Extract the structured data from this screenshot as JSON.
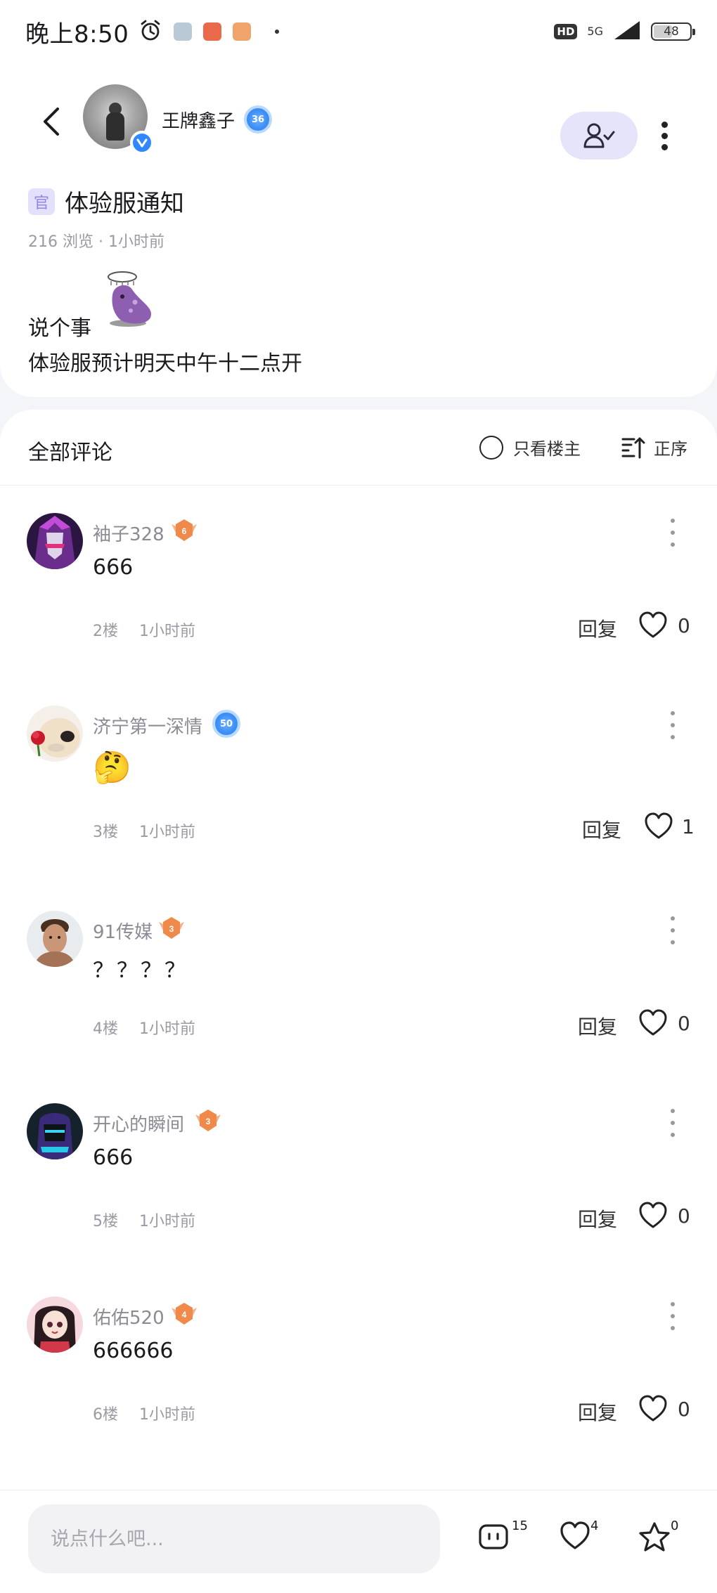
{
  "status_bar": {
    "time": "晚上8:50",
    "network_hd": "HD",
    "network_type": "5G",
    "battery_level": "48",
    "battery_fraction": 0.48
  },
  "post": {
    "author_name": "王牌鑫子",
    "author_level": "36",
    "official_tag": "官",
    "title": "体验服通知",
    "meta": "216 浏览 · 1小时前",
    "body_line_1": "说个事",
    "body_line_2": "体验服预计明天中午十二点开"
  },
  "comments_header": {
    "title": "全部评论",
    "op_only_label": "只看楼主",
    "sort_label": "正序"
  },
  "comments": [
    {
      "name": "袖子328",
      "level": "6",
      "badge": "orange",
      "text": "666",
      "floor": "2楼",
      "time": "1小时前",
      "reply": "回复",
      "likes": "0"
    },
    {
      "name": "济宁第一深情",
      "level": "50",
      "badge": "blue",
      "text": "🤔",
      "floor": "3楼",
      "time": "1小时前",
      "reply": "回复",
      "likes": "1"
    },
    {
      "name": "91传媒",
      "level": "3",
      "badge": "orange",
      "text": "？？？？",
      "floor": "4楼",
      "time": "1小时前",
      "reply": "回复",
      "likes": "0"
    },
    {
      "name": "开心的瞬间",
      "level": "3",
      "badge": "orange",
      "text": "666",
      "floor": "5楼",
      "time": "1小时前",
      "reply": "回复",
      "likes": "0"
    },
    {
      "name": "佑佑520",
      "level": "4",
      "badge": "orange",
      "text": "666666",
      "floor": "6楼",
      "time": "1小时前",
      "reply": "回复",
      "likes": "0"
    }
  ],
  "bottom_bar": {
    "input_placeholder": "说点什么吧...",
    "comment_count": "15",
    "like_count": "4",
    "star_count": "0"
  },
  "colors": {
    "accent_purple": "#e6e4fb",
    "official_tag_text": "#8f86e6",
    "verified_blue": "#2f88ff",
    "level_orange": "#f08a4b",
    "background": "#f4f5f8"
  },
  "icons": [
    "alarm-icon",
    "back-icon",
    "verified-icon",
    "followed-icon",
    "more-icon",
    "comment-icon",
    "heart-icon",
    "star-icon",
    "sort-icon",
    "radio-icon"
  ]
}
